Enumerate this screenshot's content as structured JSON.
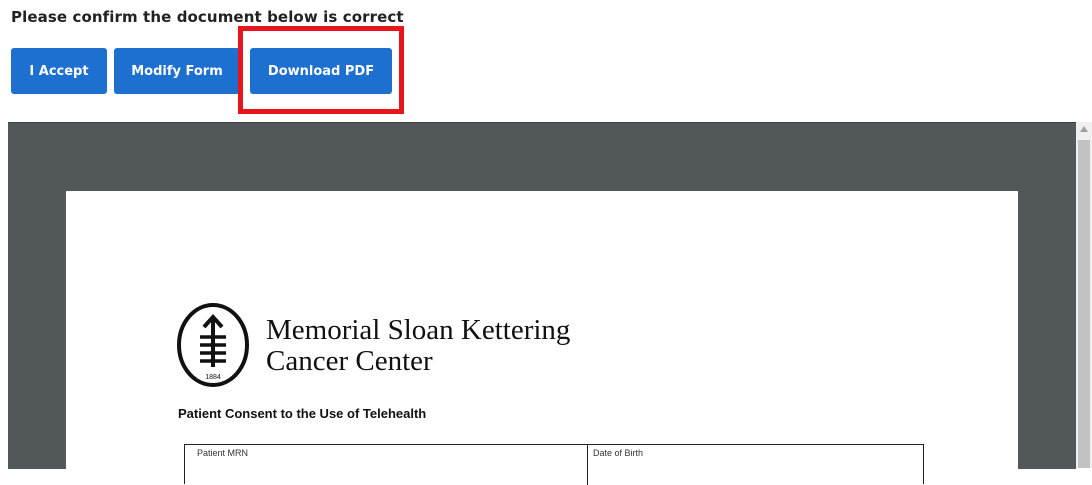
{
  "header": {
    "title": "Please confirm the document below is correct"
  },
  "toolbar": {
    "accept_label": "I Accept",
    "modify_label": "Modify Form",
    "download_label": "Download PDF"
  },
  "colors": {
    "button_blue": "#1d6fd0",
    "highlight_red": "#e8141c",
    "viewer_bg": "#52575a"
  },
  "document": {
    "logo": {
      "line1": "Memorial Sloan Kettering",
      "line2": "Cancer Center",
      "year": "1884",
      "icon": "msk-logo-icon"
    },
    "form_title": "Patient Consent to the Use of Telehealth",
    "fields": {
      "mrn_label": "Patient MRN",
      "dob_label": "Date of Birth"
    }
  }
}
